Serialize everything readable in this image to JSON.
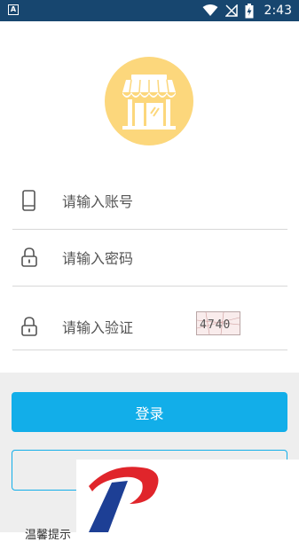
{
  "status_bar": {
    "time": "2:43",
    "icons": [
      "notification-a-icon",
      "wifi-icon",
      "signal-off-icon",
      "battery-charging-icon"
    ],
    "background": "#17466f"
  },
  "logo": {
    "icon": "storefront-icon",
    "color": "#fcd77c"
  },
  "form": {
    "account_placeholder": "请输入账号",
    "password_placeholder": "请输入密码",
    "captcha_placeholder": "请输入验证",
    "captcha_text": "4740"
  },
  "buttons": {
    "login_label": "登录",
    "accent": "#12aee9"
  },
  "footer": {
    "partial_text": "温馨提示"
  }
}
